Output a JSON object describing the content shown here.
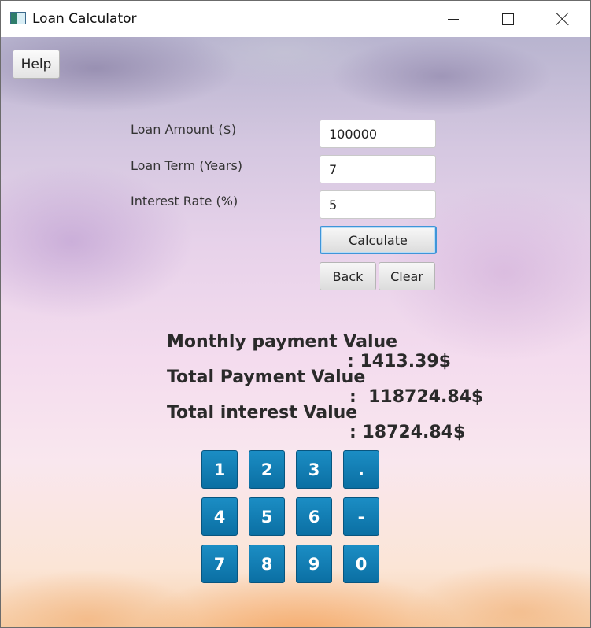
{
  "window": {
    "title": "Loan Calculator"
  },
  "toolbar": {
    "help_label": "Help"
  },
  "form": {
    "loan_amount": {
      "label": "Loan Amount ($)",
      "value": "100000"
    },
    "loan_term": {
      "label": "Loan Term (Years)",
      "value": "7"
    },
    "interest_rate": {
      "label": "Interest Rate (%)",
      "value": "5"
    }
  },
  "actions": {
    "calculate_label": "Calculate",
    "back_label": "Back",
    "clear_label": "Clear"
  },
  "results": {
    "monthly": {
      "label": "Monthly payment Value",
      "value": ": 1413.39$"
    },
    "total_payment": {
      "label": "Total Payment Value",
      "value": ":  118724.84$"
    },
    "total_interest": {
      "label": "Total interest Value",
      "value": ": 18724.84$"
    }
  },
  "keypad": {
    "keys": [
      "1",
      "2",
      "3",
      ".",
      "4",
      "5",
      "6",
      "-",
      "7",
      "8",
      "9",
      "0"
    ]
  },
  "colors": {
    "keypad_blue": "#0b7fb8",
    "focus_border": "#3f95d8"
  }
}
